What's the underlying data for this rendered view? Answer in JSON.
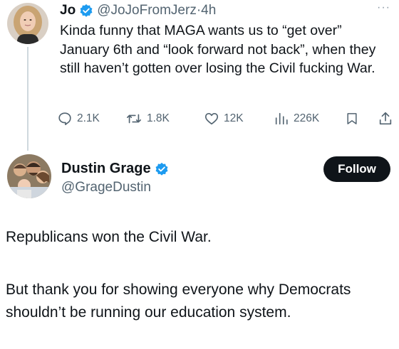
{
  "tweet": {
    "author_name": "Jo",
    "author_handle": "@JoJoFromJerz",
    "separator": "·",
    "time": "4h",
    "more_label": "···",
    "text": "Kinda funny that MAGA wants us to “get over” January 6th and “look forward not back”, when they still haven’t gotten over losing the Civil fucking War.",
    "metrics": {
      "replies": "2.1K",
      "retweets": "1.8K",
      "likes": "12K",
      "views": "226K"
    }
  },
  "reply": {
    "author_name": "Dustin Grage",
    "author_handle": "@GrageDustin",
    "follow_label": "Follow",
    "paragraph1": "Republicans won the Civil War.",
    "paragraph2": "But thank you for showing everyone why Democrats shouldn’t be running our education system."
  },
  "colors": {
    "text_primary": "#0f1419",
    "text_secondary": "#536471",
    "verified_blue": "#1d9bf0",
    "follow_bg": "#0f1419",
    "follow_text": "#ffffff"
  },
  "icons": {
    "reply": "speech-bubble-icon",
    "retweet": "retweet-icon",
    "like": "heart-icon",
    "views": "bar-chart-icon",
    "bookmark": "bookmark-icon",
    "share": "share-icon",
    "verified": "verified-badge-icon"
  }
}
